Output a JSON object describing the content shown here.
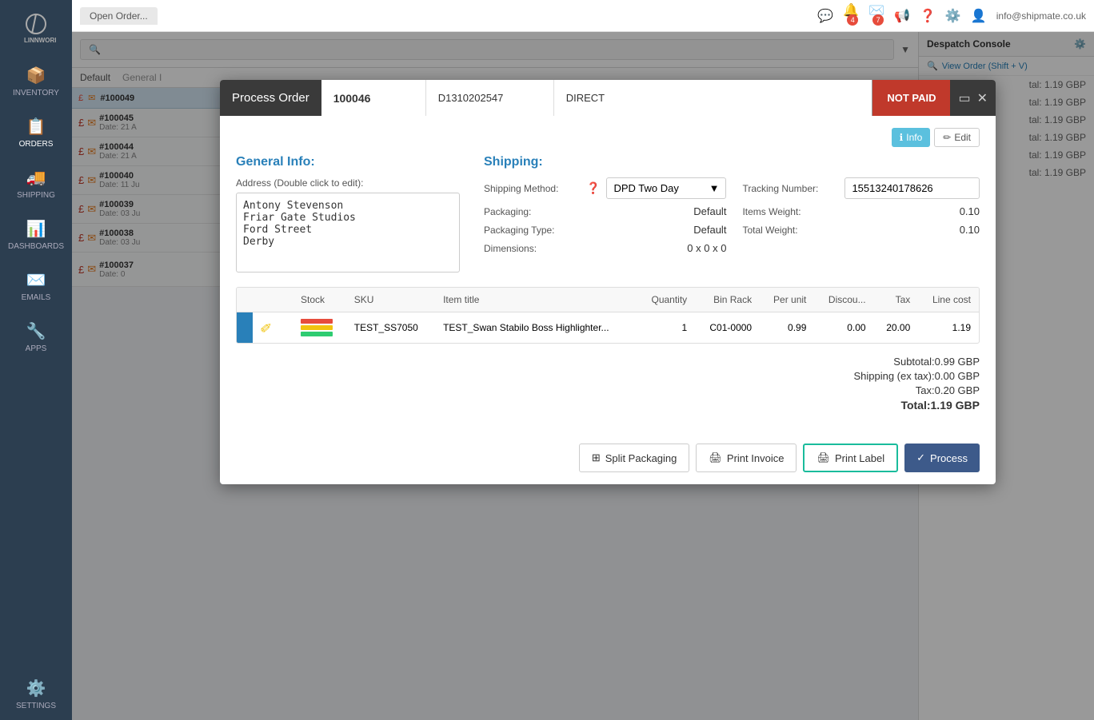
{
  "sidebar": {
    "logo": "LINNWORKS",
    "items": [
      {
        "label": "INVENTORY",
        "icon": "📦"
      },
      {
        "label": "ORDERS",
        "icon": "📋"
      },
      {
        "label": "SHIPPING",
        "icon": "🚚"
      },
      {
        "label": "DASHBOARDS",
        "icon": "📊"
      },
      {
        "label": "EMAILS",
        "icon": "✉️"
      },
      {
        "label": "APPS",
        "icon": "🔧"
      },
      {
        "label": "SETTINGS",
        "icon": "⚙️"
      }
    ]
  },
  "topbar": {
    "tab": "Open Order...",
    "email": "info@shipmate.co.uk",
    "notification_count": "4",
    "mail_count": "7"
  },
  "modal": {
    "title": "Process Order",
    "order_number": "100046",
    "reference": "D1310202547",
    "channel": "DIRECT",
    "payment_status": "NOT PAID",
    "info_button": "Info",
    "edit_button": "Edit",
    "general_info": {
      "title": "General Info:",
      "address_label": "Address (Double click to edit):",
      "address_lines": [
        "Antony Stevenson",
        "Friar Gate Studios",
        "Ford Street",
        "Derby"
      ]
    },
    "shipping": {
      "title": "Shipping:",
      "method_label": "Shipping Method:",
      "method_value": "DPD Two Day",
      "packaging_label": "Packaging:",
      "packaging_value": "Default",
      "packaging_type_label": "Packaging Type:",
      "packaging_type_value": "Default",
      "dimensions_label": "Dimensions:",
      "dimensions_value": "0 x 0 x 0",
      "tracking_label": "Tracking Number:",
      "tracking_value": "15513240178626",
      "items_weight_label": "Items Weight:",
      "items_weight_value": "0.10",
      "total_weight_label": "Total Weight:",
      "total_weight_value": "0.10"
    },
    "table": {
      "headers": [
        "",
        "Stock",
        "SKU",
        "Item title",
        "Quantity",
        "Bin Rack",
        "Per unit",
        "Discou...",
        "Tax",
        "Line cost"
      ],
      "rows": [
        {
          "sku": "TEST_SS7050",
          "title": "TEST_Swan Stabilo Boss Highlighter...",
          "quantity": "1",
          "bin_rack": "C01-0000",
          "per_unit": "0.99",
          "discount": "0.00",
          "tax": "20.00",
          "line_cost": "1.19"
        }
      ]
    },
    "totals": {
      "subtotal_label": "Subtotal:",
      "subtotal_value": "0.99 GBP",
      "shipping_label": "Shipping (ex tax):",
      "shipping_value": "0.00 GBP",
      "tax_label": "Tax:",
      "tax_value": "0.20 GBP",
      "total_label": "Total:",
      "total_value": "1.19 GBP"
    },
    "buttons": {
      "split_packaging": "Split Packaging",
      "print_invoice": "Print Invoice",
      "print_label": "Print Label",
      "process": "Process"
    }
  },
  "background": {
    "despatch_title": "Despatch Console",
    "view_order": "View Order (Shift + V)",
    "order_rows": [
      {
        "id": "#100045",
        "date": "Date: 21 A",
        "total": "tal: 1.19 GBP"
      },
      {
        "id": "#100044",
        "date": "Date: 21 A",
        "total": "tal: 1.19 GBP"
      },
      {
        "id": "#100040",
        "date": "Date: 11 Ju",
        "total": "tal: 1.19 GBP"
      },
      {
        "id": "#100039",
        "date": "Date: 03 Ju",
        "total": "tal: 1.19 GBP"
      },
      {
        "id": "#100038",
        "date": "Date: 03 Ju",
        "total": "tal: 1.19 GBP"
      },
      {
        "id": "#100037",
        "date": "Date: 0",
        "total": ""
      }
    ]
  }
}
